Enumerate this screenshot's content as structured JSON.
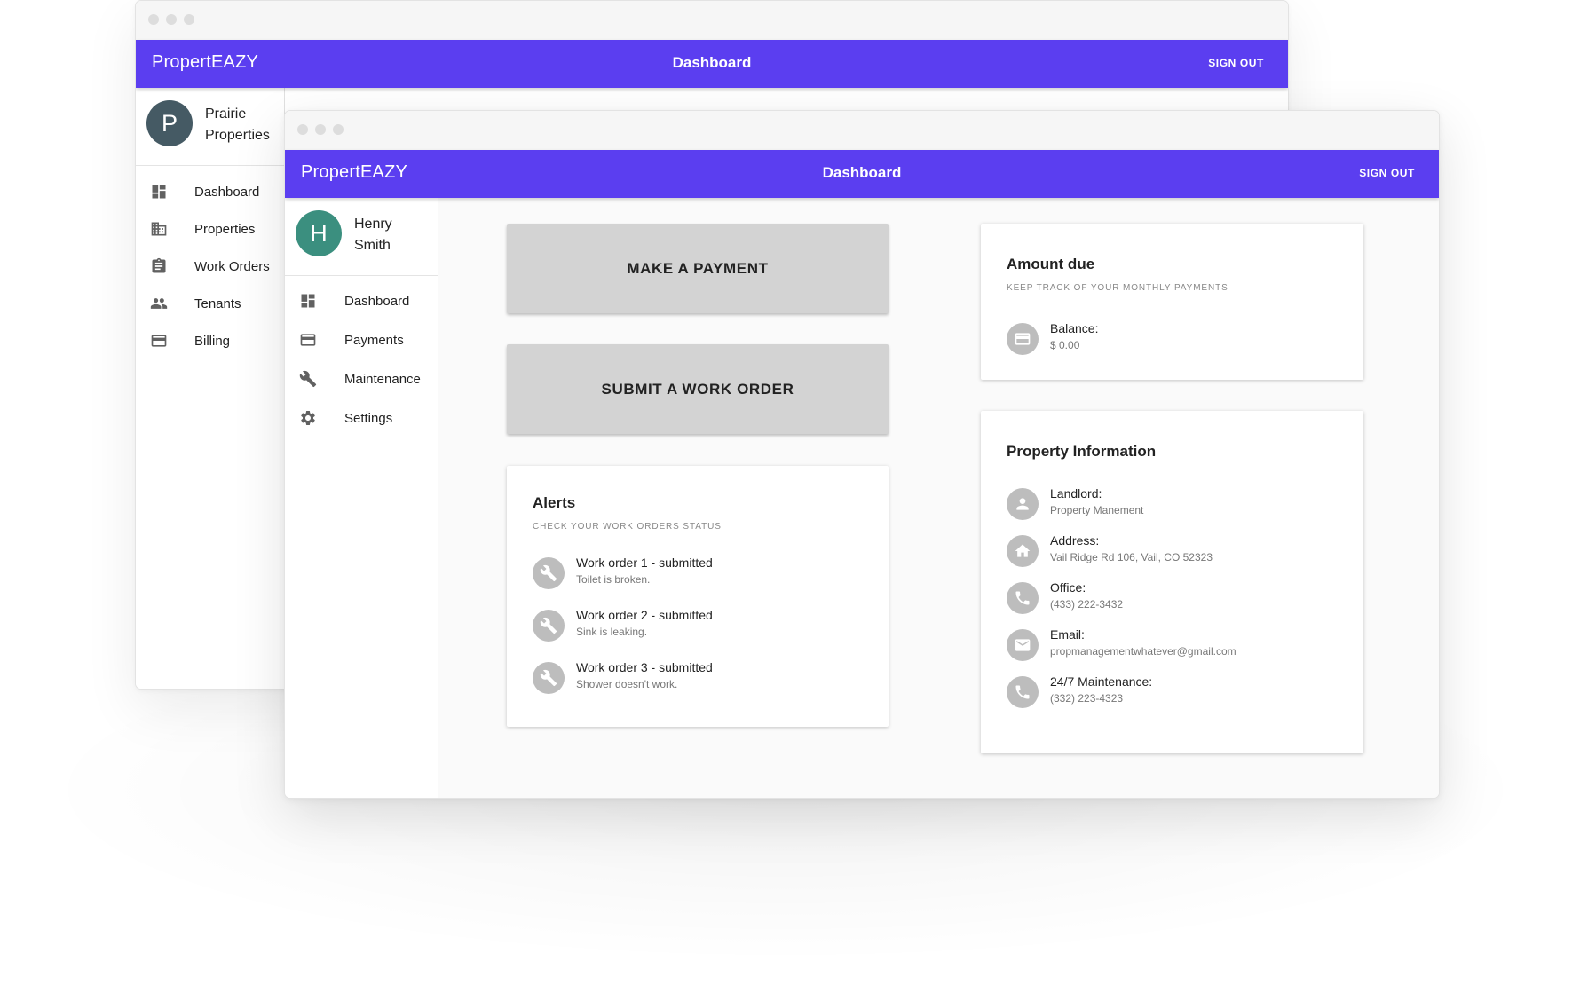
{
  "back_window": {
    "app_name": "PropertEAZY",
    "title": "Dashboard",
    "sign_out": "SIGN OUT",
    "profile": {
      "initial": "P",
      "name_line1": "Prairie",
      "name_line2": "Properties"
    },
    "nav": [
      {
        "label": "Dashboard",
        "icon": "dashboard-icon"
      },
      {
        "label": "Properties",
        "icon": "building-icon"
      },
      {
        "label": "Work Orders",
        "icon": "clipboard-icon"
      },
      {
        "label": "Tenants",
        "icon": "people-icon"
      },
      {
        "label": "Billing",
        "icon": "credit-card-icon"
      }
    ]
  },
  "front_window": {
    "app_name": "PropertEAZY",
    "title": "Dashboard",
    "sign_out": "SIGN OUT",
    "profile": {
      "initial": "H",
      "name_line1": "Henry",
      "name_line2": "Smith"
    },
    "nav": [
      {
        "label": "Dashboard",
        "icon": "dashboard-icon"
      },
      {
        "label": "Payments",
        "icon": "credit-card-icon"
      },
      {
        "label": "Maintenance",
        "icon": "wrench-icon"
      },
      {
        "label": "Settings",
        "icon": "gear-icon"
      }
    ],
    "buttons": {
      "make_payment": "MAKE A PAYMENT",
      "submit_work_order": "SUBMIT A WORK ORDER"
    },
    "alerts": {
      "title": "Alerts",
      "subtitle": "CHECK YOUR WORK ORDERS STATUS",
      "items": [
        {
          "title": "Work order 1 - submitted",
          "detail": "Toilet is broken.",
          "icon": "wrench-icon"
        },
        {
          "title": "Work order 2 - submitted",
          "detail": "Sink is leaking.",
          "icon": "wrench-icon"
        },
        {
          "title": "Work order 3 - submitted",
          "detail": "Shower doesn't work.",
          "icon": "wrench-icon"
        }
      ]
    },
    "amount_due": {
      "title": "Amount due",
      "subtitle": "KEEP TRACK OF YOUR MONTHLY PAYMENTS",
      "balance_label": "Balance:",
      "balance_value": "$ 0.00",
      "icon": "credit-card-icon"
    },
    "property_info": {
      "title": "Property Information",
      "items": [
        {
          "label": "Landlord:",
          "value": "Property Manement",
          "icon": "person-icon"
        },
        {
          "label": "Address:",
          "value": "Vail Ridge Rd 106, Vail, CO 52323",
          "icon": "home-icon"
        },
        {
          "label": "Office:",
          "value": "(433) 222-3432",
          "icon": "phone-icon"
        },
        {
          "label": "Email:",
          "value": "propmanagementwhatever@gmail.com",
          "icon": "mail-icon"
        },
        {
          "label": "24/7 Maintenance:",
          "value": "(332) 223-4323",
          "icon": "phone-icon"
        }
      ]
    }
  },
  "colors": {
    "app_bar": "#5b3ef0",
    "avatar_back": "#455a64",
    "avatar_front": "#3b8f7f",
    "button_bg": "#d3d3d3",
    "icon_circle": "#bdbdbd"
  }
}
